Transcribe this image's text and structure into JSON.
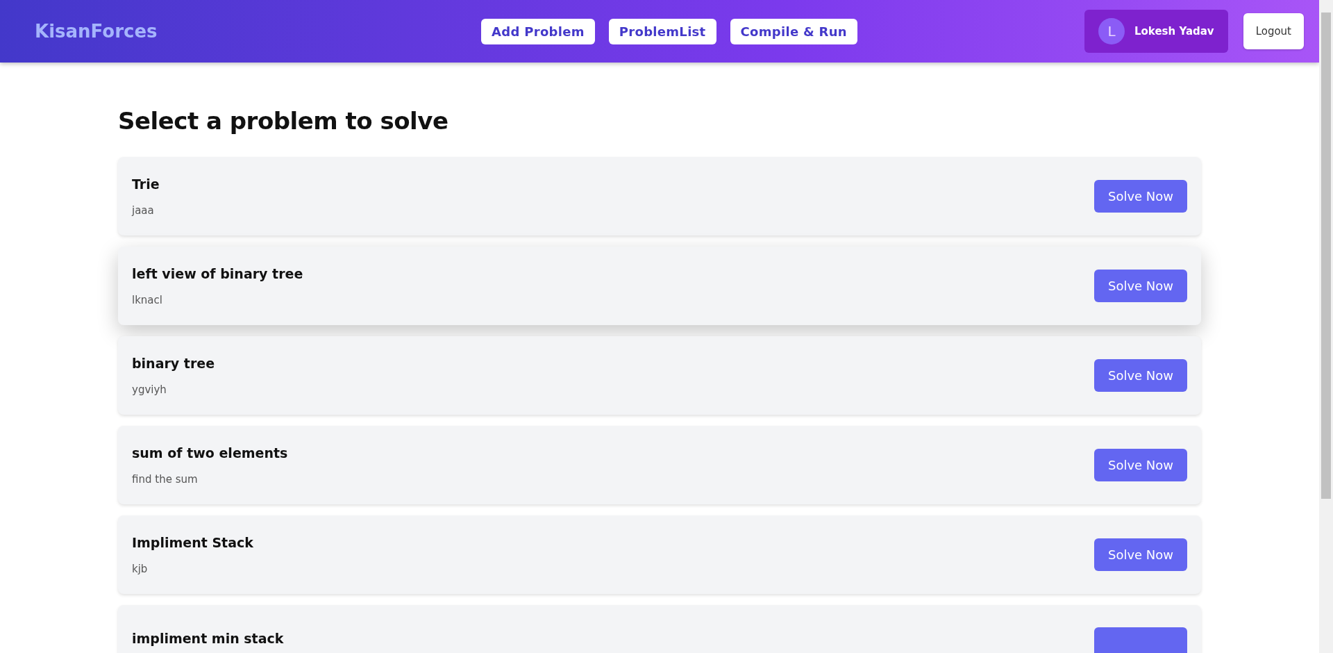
{
  "header": {
    "logo": "KisanForces",
    "nav": [
      {
        "label": "Add Problem"
      },
      {
        "label": "ProblemList"
      },
      {
        "label": "Compile & Run"
      }
    ],
    "user": {
      "initial": "L",
      "name": "Lokesh Yadav"
    },
    "logout": "Logout"
  },
  "heading": "Select a problem to solve",
  "problems": [
    {
      "title": "Trie",
      "description": "jaaa",
      "action": "Solve Now",
      "hovered": false
    },
    {
      "title": "left view of binary tree",
      "description": "lknacl",
      "action": "Solve Now",
      "hovered": true
    },
    {
      "title": "binary tree",
      "description": "ygviyh",
      "action": "Solve Now",
      "hovered": false
    },
    {
      "title": "sum of two elements",
      "description": "find the sum",
      "action": "Solve Now",
      "hovered": false
    },
    {
      "title": "Impliment Stack",
      "description": "kjb",
      "action": "Solve Now",
      "hovered": false
    },
    {
      "title": "impliment min stack",
      "hovered": false
    }
  ]
}
